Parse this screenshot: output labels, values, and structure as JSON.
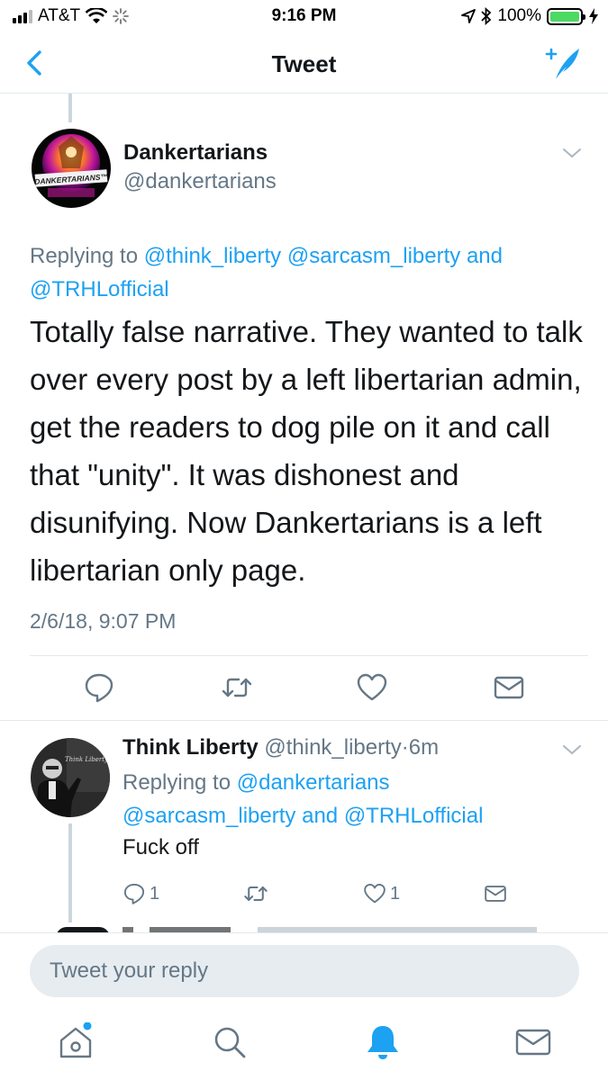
{
  "status_bar": {
    "carrier": "AT&T",
    "time": "9:16 PM",
    "battery": "100%",
    "battery_level": 1.0
  },
  "nav": {
    "title": "Tweet",
    "back_icon": "chevron-left-icon",
    "compose_icon": "compose-tweet-icon"
  },
  "main_tweet": {
    "name": "Dankertarians",
    "handle": "@dankertarians",
    "avatar_logo_text": "DANKERTARIANS™",
    "replying_prefix": "Replying to",
    "replying_to": [
      "@think_liberty",
      "@sarcasm_liberty",
      "@TRHLofficial"
    ],
    "replying_and": "and",
    "text": "Totally false narrative. They wanted to talk over every post by a left libertarian admin, get the readers to dog pile on it and call that \"unity\". It was dishonest and disunifying. Now Dankertarians is a left libertarian only page.",
    "timestamp": "2/6/18, 9:07 PM",
    "actions": [
      "reply-icon",
      "retweet-icon",
      "like-icon",
      "message-icon"
    ]
  },
  "reply_tweet": {
    "name": "Think Liberty",
    "handle": "@think_liberty",
    "separator": "·",
    "time": "6m",
    "replying_prefix": "Replying to",
    "replying_to": [
      "@dankertarians",
      "@sarcasm_liberty",
      "@TRHLofficial"
    ],
    "replying_and": "and",
    "text": "Fuck off",
    "reply_count": "1",
    "like_count": "1"
  },
  "reply_bar": {
    "placeholder": "Tweet your reply"
  },
  "tab_bar": {
    "tabs": [
      "home-icon",
      "search-icon",
      "notifications-icon",
      "messages-icon"
    ],
    "active": "notifications-icon",
    "accent": "#1da1f2"
  },
  "colors": {
    "accent": "#1da1f2",
    "text": "#14171a",
    "secondary": "#657786",
    "divider": "#e1e8ed"
  }
}
